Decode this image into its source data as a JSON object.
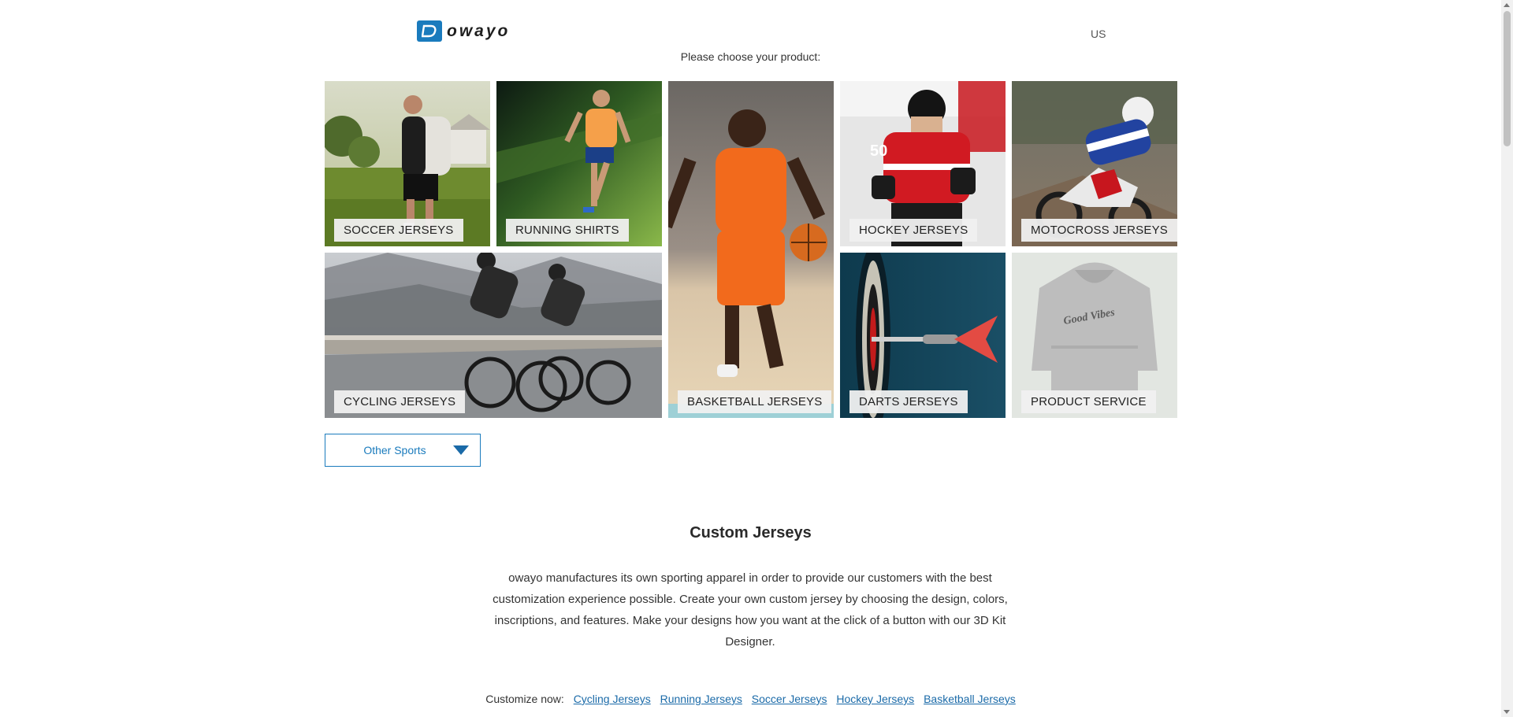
{
  "header": {
    "brand": "owayo",
    "region": "US"
  },
  "choose_text": "Please choose your product:",
  "tiles": [
    {
      "label": "SOCCER JERSEYS"
    },
    {
      "label": "RUNNING SHIRTS"
    },
    {
      "label": "BASKETBALL JERSEYS"
    },
    {
      "label": "HOCKEY JERSEYS"
    },
    {
      "label": "MOTOCROSS JERSEYS"
    },
    {
      "label": "CYCLING JERSEYS"
    },
    {
      "label": "DARTS JERSEYS"
    },
    {
      "label": "PRODUCT SERVICE"
    }
  ],
  "other_sports": "Other Sports",
  "section": {
    "title": "Custom Jerseys",
    "intro": "owayo manufactures its own sporting apparel in order to provide our customers with the best customization experience possible. Create your own custom jersey by choosing the design, colors, inscriptions, and features. Make your designs how you want at the click of a button with our 3D Kit Designer."
  },
  "customize": {
    "prefix": "Customize now:",
    "links": [
      "Cycling Jerseys",
      "Running Jerseys",
      "Soccer Jerseys",
      "Hockey Jerseys",
      "Basketball Jerseys"
    ]
  },
  "colors": {
    "brand_blue": "#1a7bbd"
  }
}
